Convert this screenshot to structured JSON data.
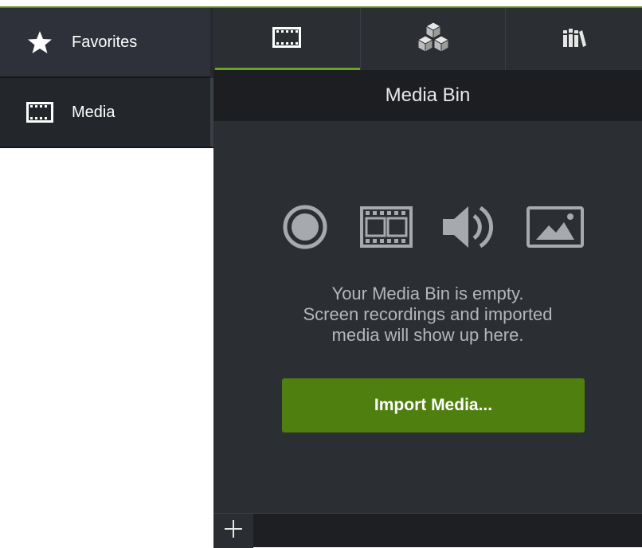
{
  "sidebar": {
    "items": [
      {
        "label": "Favorites",
        "icon": "star-icon"
      },
      {
        "label": "Media",
        "icon": "film-icon"
      }
    ]
  },
  "tabs": [
    {
      "icon": "film-icon",
      "active": true
    },
    {
      "icon": "cubes-icon",
      "active": false
    },
    {
      "icon": "library-icon",
      "active": false
    }
  ],
  "bin": {
    "header": "Media Bin",
    "empty_message": [
      "Your Media Bin is empty.",
      "Screen recordings and imported",
      "media will show up here."
    ],
    "media_type_icons": [
      "record-icon",
      "film-icon",
      "audio-icon",
      "image-icon"
    ],
    "import_label": "Import Media..."
  },
  "bottom_bar": {
    "add_label": "+"
  },
  "colors": {
    "accent": "#6ba32a",
    "button": "#4f7f0f",
    "panel_bg": "#2b2e33",
    "header_bg": "#1c1e22",
    "sidebar_bg": "#26292e"
  }
}
